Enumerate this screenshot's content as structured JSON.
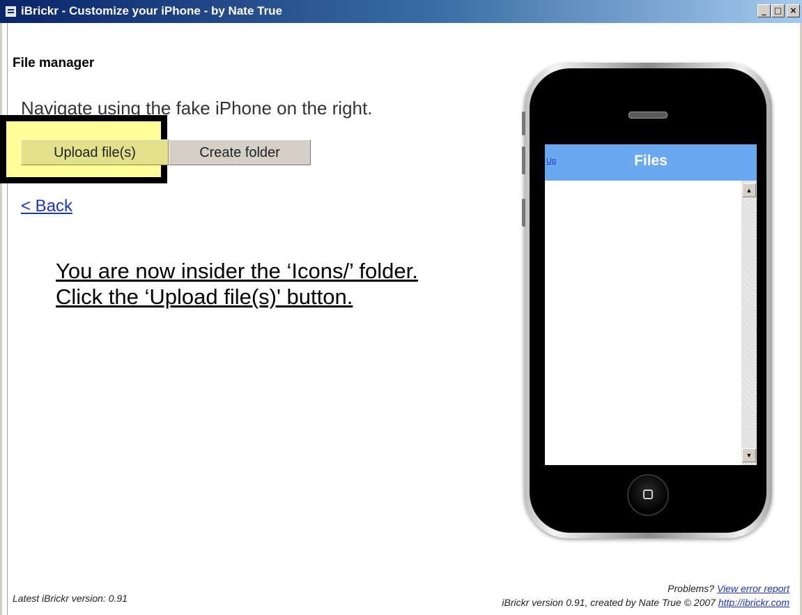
{
  "window": {
    "title": "iBrickr - Customize your iPhone - by Nate True",
    "minimize_glyph": "_",
    "maximize_glyph": "□",
    "close_glyph": "×"
  },
  "page": {
    "section_title": "File manager",
    "nav_hint": "Navigate using the fake iPhone on the right.",
    "upload_button": "Upload file(s)",
    "create_folder_button": "Create folder",
    "back_link": "< Back",
    "instruction": "You are now insider the ‘Icons/’ folder.  Click the ‘Upload file(s)' button."
  },
  "iphone": {
    "up_link": "Up",
    "screen_title": "Files",
    "scroll_up_glyph": "▲",
    "scroll_down_glyph": "▼"
  },
  "footer": {
    "latest_version": "Latest iBrickr version: 0.91",
    "problems_prefix": "Problems?",
    "error_report_link": "View error report",
    "credit": "iBrickr version 0.91, created by Nate True © 2007",
    "site_link": "http://ibrickr.com"
  },
  "colors": {
    "titlebar_start": "#0a246a",
    "highlight_fill": "#ffff99",
    "link": "#1a33c8",
    "screen_header": "#6aa9f2"
  }
}
